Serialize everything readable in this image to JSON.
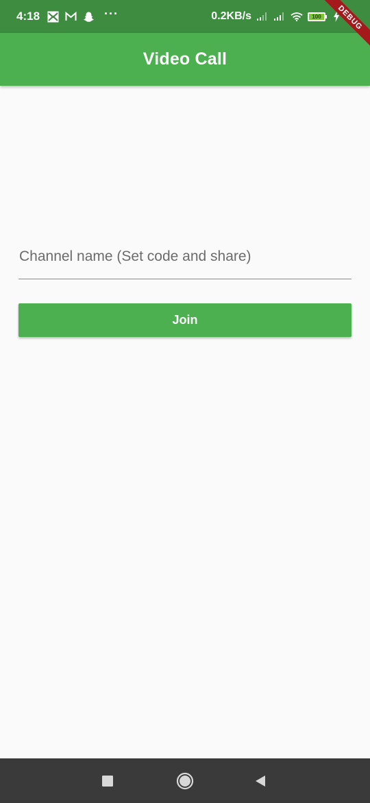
{
  "status_bar": {
    "time": "4:18",
    "speed": "0.2KB/s",
    "battery": "100",
    "icons": [
      "news-icon",
      "gmail-icon",
      "snapchat-icon",
      "more-dots-icon",
      "signal-icon",
      "signal-icon",
      "wifi-icon",
      "battery-icon",
      "charging-icon"
    ]
  },
  "debug_banner": "DEBUG",
  "app_bar": {
    "title": "Video Call"
  },
  "form": {
    "channel_placeholder": "Channel name (Set code and share)",
    "channel_value": "",
    "join_label": "Join"
  },
  "nav_bar": {
    "buttons": [
      "recents-icon",
      "home-icon",
      "back-icon"
    ]
  },
  "colors": {
    "primary": "#4caf50",
    "status_bar": "#3d8c40",
    "background": "#fafafa",
    "nav_bar": "#3a3a3a",
    "debug_banner": "#a3191c"
  }
}
